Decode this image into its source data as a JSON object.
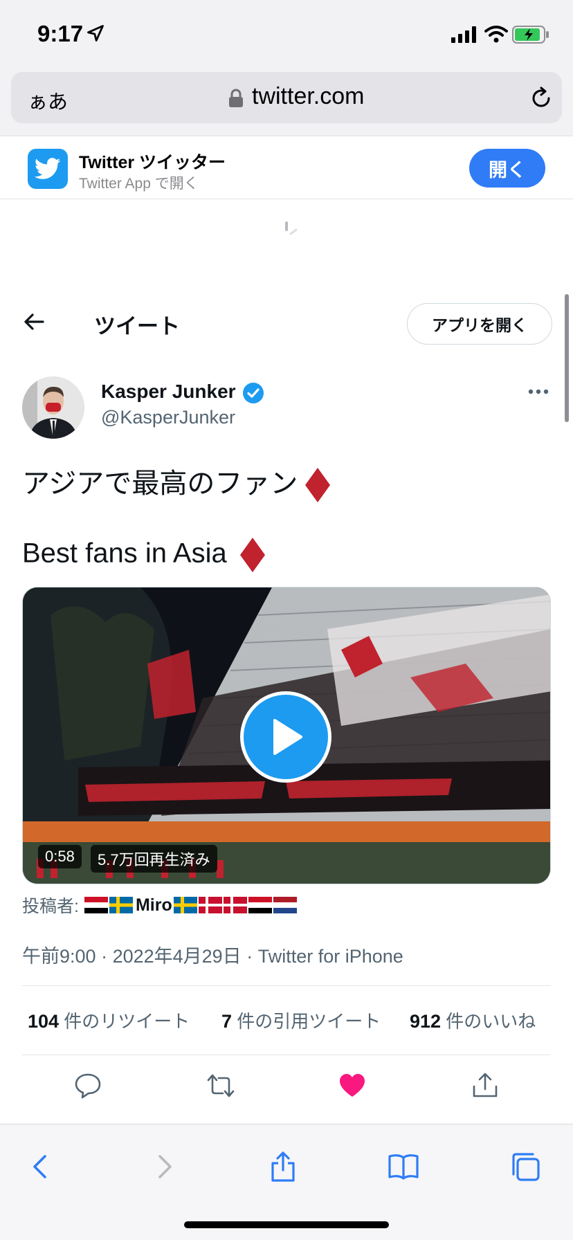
{
  "status_bar": {
    "time": "9:17"
  },
  "browser": {
    "aa_label": "ぁあ",
    "url": "twitter.com"
  },
  "app_banner": {
    "title": "Twitter ツイッター",
    "subtitle": "Twitter App で開く",
    "open_label": "開く"
  },
  "header": {
    "title": "ツイート",
    "open_app_label": "アプリを開く"
  },
  "author": {
    "name": "Kasper Junker",
    "handle": "@KasperJunker"
  },
  "tweet": {
    "line1": "アジアで最高のファン",
    "line2": "Best fans in Asia",
    "accent_color": "#c0222e"
  },
  "video": {
    "duration": "0:58",
    "views": "5.7万回再生済み"
  },
  "posted_by": {
    "label": "投稿者:",
    "name": "Miro"
  },
  "meta": {
    "time": "午前9:00",
    "date": "2022年4月29日",
    "source": "Twitter for iPhone",
    "separator": " · "
  },
  "stats": {
    "retweets_count": "104",
    "retweets_label": "件のリツイート",
    "quotes_count": "7",
    "quotes_label": "件の引用ツイート",
    "likes_count": "912",
    "likes_label": "件のいいね"
  },
  "colors": {
    "twitter_blue": "#1d9bf0",
    "like_pink": "#f91880",
    "ios_blue": "#2f7cf6"
  }
}
